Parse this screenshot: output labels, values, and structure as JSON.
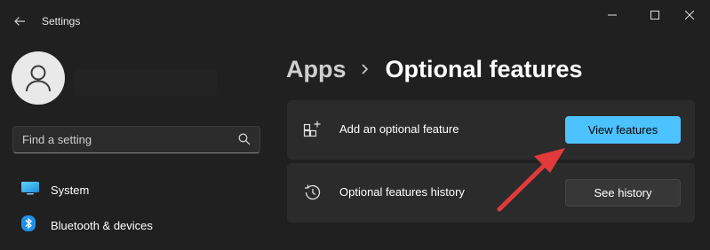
{
  "window": {
    "title": "Settings",
    "controls": [
      "minimize",
      "maximize",
      "close"
    ]
  },
  "search": {
    "placeholder": "Find a setting",
    "icon": "search-icon"
  },
  "sidebar": {
    "items": [
      {
        "label": "System",
        "icon": "monitor-icon"
      },
      {
        "label": "Bluetooth & devices",
        "icon": "bluetooth-icon"
      }
    ]
  },
  "breadcrumb": {
    "parent": "Apps",
    "current": "Optional features"
  },
  "cards": [
    {
      "label": "Add an optional feature",
      "icon": "add-feature-icon",
      "button": "View features"
    },
    {
      "label": "Optional features history",
      "icon": "history-icon",
      "button": "See history"
    }
  ],
  "colors": {
    "background": "#202020",
    "card": "#2b2b2b",
    "accent": "#4cc2ff",
    "annotation_arrow": "#e23a3a"
  }
}
